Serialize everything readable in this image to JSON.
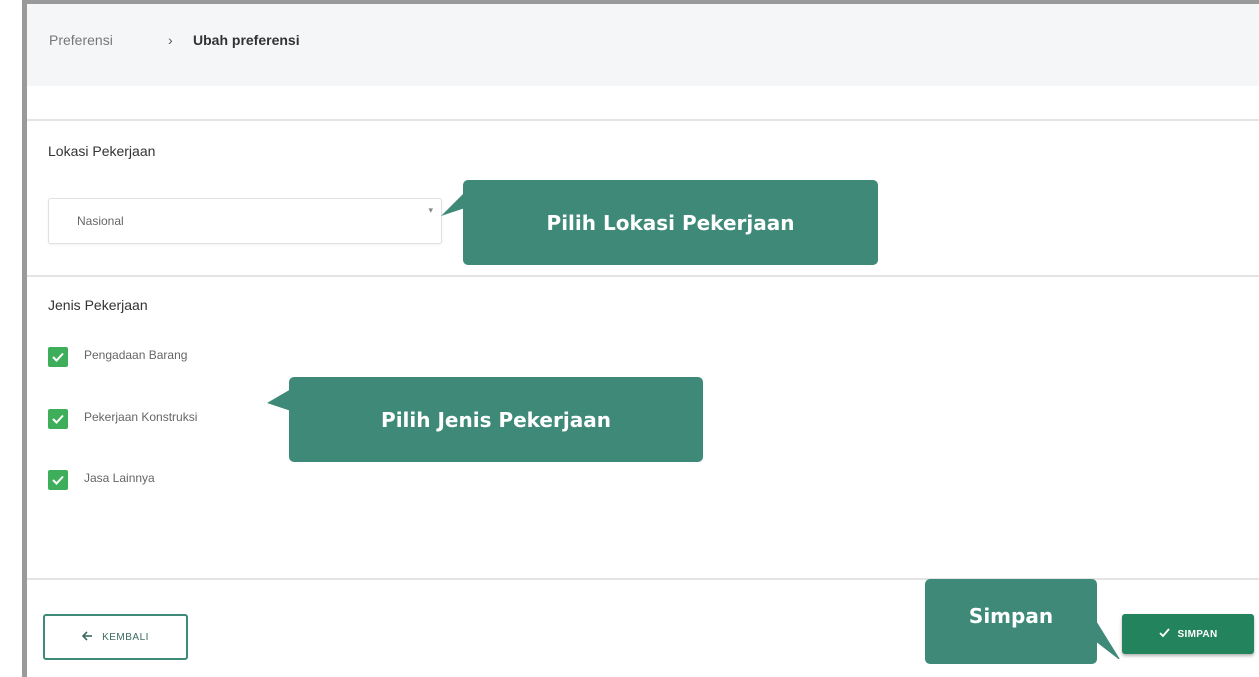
{
  "breadcrumb": {
    "parent": "Preferensi",
    "separator": "›",
    "current": "Ubah preferensi"
  },
  "location": {
    "label": "Lokasi Pekerjaan",
    "selected": "Nasional",
    "arrow": "▾"
  },
  "job_types": {
    "label": "Jenis Pekerjaan",
    "items": [
      {
        "label": "Pengadaan Barang",
        "checked": true
      },
      {
        "label": "Pekerjaan Konstruksi",
        "checked": true
      },
      {
        "label": "Jasa Lainnya",
        "checked": true
      }
    ]
  },
  "callouts": {
    "location": "Pilih Lokasi Pekerjaan",
    "job_types": "Pilih Jenis Pekerjaan",
    "save": "Simpan"
  },
  "buttons": {
    "back": {
      "icon": "arrow-left-icon",
      "label": "KEMBALI"
    },
    "save": {
      "icon": "check-icon",
      "label": "SIMPAN"
    }
  },
  "colors": {
    "accent": "#3e8978",
    "checkbox": "#3fae5a",
    "save_button": "#22835c"
  }
}
